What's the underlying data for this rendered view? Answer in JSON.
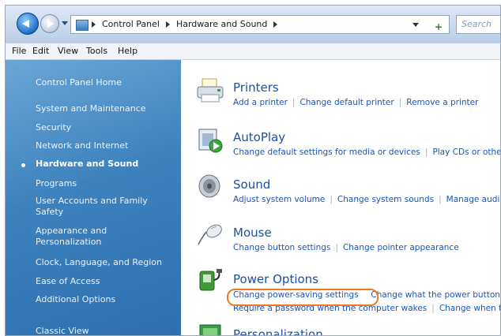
{
  "addressbar": {
    "crumbs": [
      "Control Panel",
      "Hardware and Sound"
    ],
    "search_placeholder": "Search"
  },
  "menubar": {
    "items": [
      "File",
      "Edit",
      "View",
      "Tools",
      "Help"
    ]
  },
  "sidebar": {
    "home": "Control Panel Home",
    "items": [
      "System and Maintenance",
      "Security",
      "Network and Internet",
      "Hardware and Sound",
      "Programs",
      "User Accounts and Family Safety",
      "Appearance and Personalization",
      "Clock, Language, and Region",
      "Ease of Access",
      "Additional Options"
    ],
    "selected": "Hardware and Sound",
    "classic_view": "Classic View"
  },
  "categories": [
    {
      "title": "Printers",
      "icon": "printer-icon",
      "links": [
        "Add a printer",
        "Change default printer",
        "Remove a printer"
      ]
    },
    {
      "title": "AutoPlay",
      "icon": "autoplay-icon",
      "links": [
        "Change default settings for media or devices",
        "Play CDs or other media automatically"
      ]
    },
    {
      "title": "Sound",
      "icon": "speaker-icon",
      "links": [
        "Adjust system volume",
        "Change system sounds",
        "Manage audio devices"
      ]
    },
    {
      "title": "Mouse",
      "icon": "mouse-icon",
      "links": [
        "Change button settings",
        "Change pointer appearance"
      ]
    },
    {
      "title": "Power Options",
      "icon": "power-icon",
      "links": [
        "Change power-saving settings",
        "Change what the power buttons do"
      ],
      "links2": [
        "Require a password when the computer wakes",
        "Change when the computer sleeps"
      ]
    },
    {
      "title": "Personalization",
      "icon": "personalization-icon"
    }
  ],
  "colors": {
    "highlight": "#f07a23",
    "link": "#1a55b8",
    "title": "#1e4fa0",
    "sidebar": "#3e82bd"
  }
}
